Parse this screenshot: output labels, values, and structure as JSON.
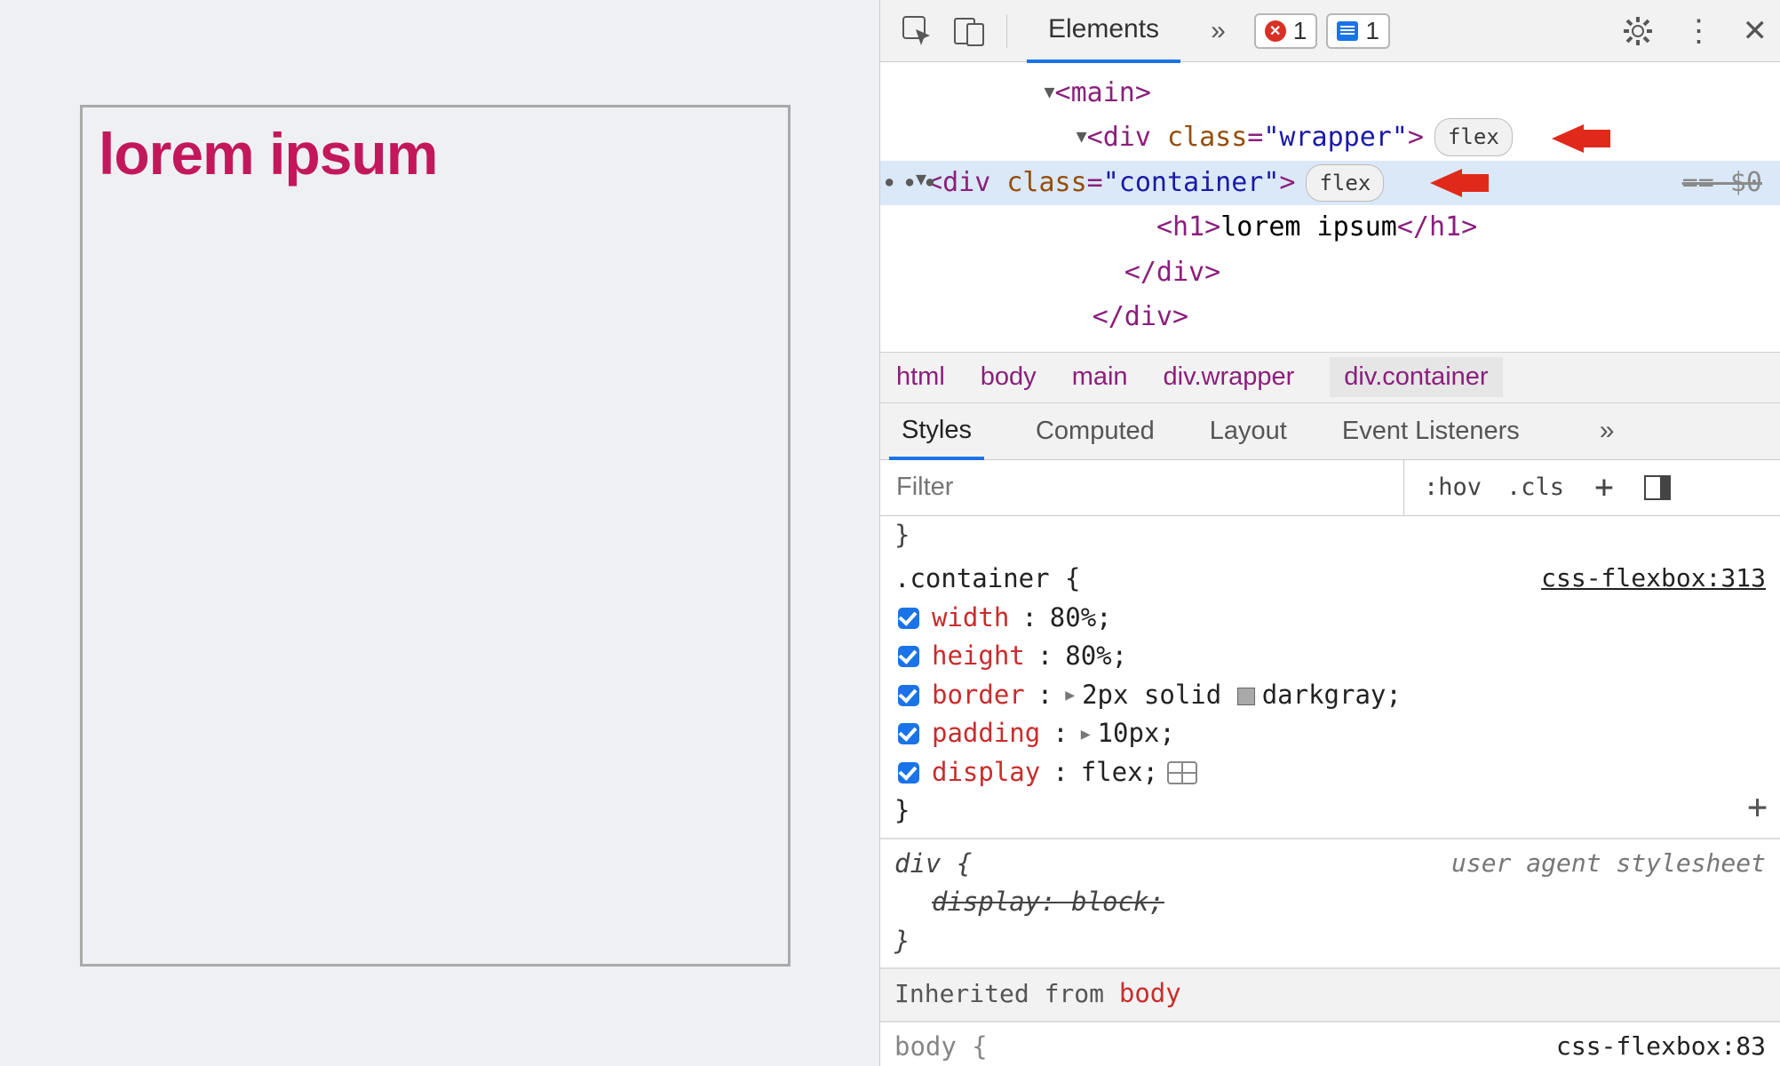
{
  "preview": {
    "heading": "lorem ipsum"
  },
  "toolbar": {
    "tab_elements": "Elements",
    "error_count": "1",
    "message_count": "1"
  },
  "dom": {
    "main_open": "<main>",
    "wrapper_open_prefix": "<div ",
    "wrapper_attr": "class",
    "wrapper_val": "\"wrapper\"",
    "wrapper_open_suffix": ">",
    "wrapper_pill": "flex",
    "container_open_prefix": "<div ",
    "container_attr": "class",
    "container_val": "\"container\"",
    "container_open_suffix": ">",
    "container_pill": "flex",
    "selected_marker": "== $0",
    "h1_open": "<h1>",
    "h1_text": "lorem ipsum",
    "h1_close": "</h1>",
    "div_close1": "</div>",
    "div_close2": "</div>"
  },
  "breadcrumbs": {
    "c0": "html",
    "c1": "body",
    "c2": "main",
    "c3": "div.wrapper",
    "c4": "div.container"
  },
  "subtabs": {
    "styles": "Styles",
    "computed": "Computed",
    "layout": "Layout",
    "events": "Event Listeners"
  },
  "filter": {
    "placeholder": "Filter",
    "hov": ":hov",
    "cls": ".cls"
  },
  "css": {
    "truncated_top": "}",
    "rule1": {
      "selector": ".container {",
      "source": "css-flexbox:313",
      "p1": {
        "name": "width",
        "val": "80%;"
      },
      "p2": {
        "name": "height",
        "val": "80%;"
      },
      "p3": {
        "name": "border",
        "val": "2px solid ",
        "color_name": "darkgray;"
      },
      "p4": {
        "name": "padding",
        "val": "10px;"
      },
      "p5": {
        "name": "display",
        "val": "flex;"
      },
      "close": "}"
    },
    "ua": {
      "selector": "div {",
      "note": "user agent stylesheet",
      "prop": "display: block;",
      "close": "}"
    },
    "inherited": {
      "label": "Inherited from ",
      "from": "body"
    },
    "peek": {
      "selector": "body {",
      "source": "css-flexbox:83"
    }
  }
}
